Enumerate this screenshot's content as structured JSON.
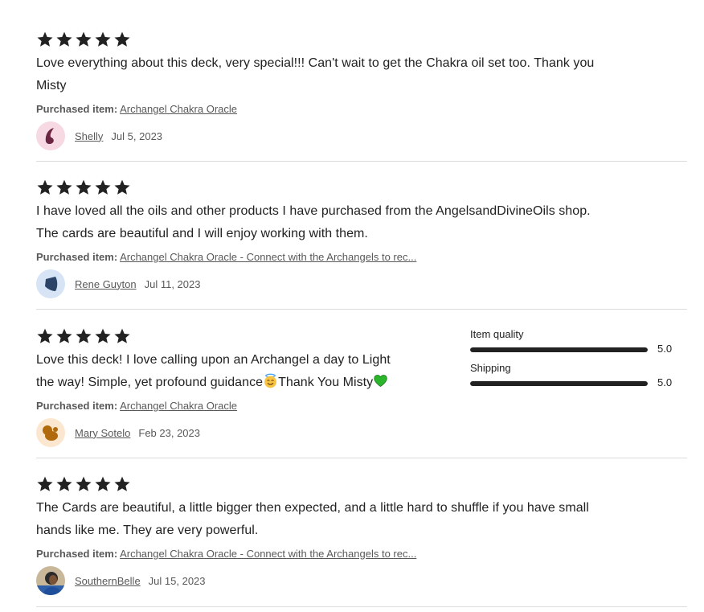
{
  "reviews": [
    {
      "rating": 5,
      "text_line1": "Love everything about this deck, very special!!! Can't wait to get the Chakra oil set too. Thank you",
      "text_line2": "Misty",
      "purchased_label": "Purchased item:",
      "purchased_item": "Archangel Chakra Oracle",
      "user": "Shelly",
      "date": "Jul 5, 2023"
    },
    {
      "rating": 5,
      "text_line1": "I have loved all the oils and other products I have purchased from the AngelsandDivineOils shop.",
      "text_line2": "The cards are beautiful and I will enjoy working with them.",
      "purchased_label": "Purchased item:",
      "purchased_item": "Archangel Chakra Oracle - Connect with the Archangels to rec...",
      "user": "Rene Guyton",
      "date": "Jul 11, 2023"
    },
    {
      "rating": 5,
      "text_line1": "Love this deck! I love calling upon an Archangel a day to Light",
      "text_line2a": "the way! Simple, yet profound guidance",
      "text_line2b": "Thank You Misty",
      "purchased_label": "Purchased item:",
      "purchased_item": "Archangel Chakra Oracle",
      "user": "Mary Sotelo",
      "date": "Feb 23, 2023",
      "ratings": [
        {
          "label": "Item quality",
          "value": "5.0",
          "fraction": 1.0
        },
        {
          "label": "Shipping",
          "value": "5.0",
          "fraction": 1.0
        }
      ]
    },
    {
      "rating": 5,
      "text_line1": "The Cards are beautiful, a little bigger then expected, and a little hard to shuffle if you have small",
      "text_line2": "hands like me. They are very powerful.",
      "purchased_label": "Purchased item:",
      "purchased_item": "Archangel Chakra Oracle - Connect with the Archangels to rec...",
      "user": "SouthernBelle",
      "date": "Jul 15, 2023"
    }
  ],
  "icons": {
    "star": "star-icon",
    "emoji_smile": "smiling-face-with-halo",
    "emoji_heart": "green-heart"
  },
  "colors": {
    "text": "#222222",
    "muted": "#595959",
    "divider": "#dcdcdc",
    "avatar_shelly_bg": "#f6d9e3",
    "avatar_shelly_fg": "#6b2540",
    "avatar_rene_bg": "#d6e4f5",
    "avatar_rene_fg": "#2c4468",
    "avatar_mary_bg": "#fbe7cf",
    "avatar_mary_fg": "#b0690c",
    "heart": "#2ab52a"
  }
}
